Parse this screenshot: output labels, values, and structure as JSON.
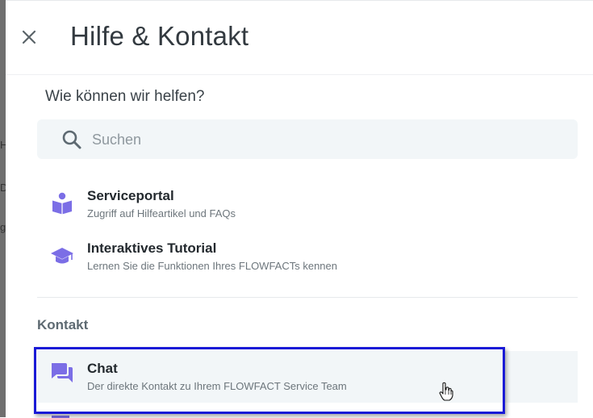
{
  "backdrop": {
    "letters": [
      "H",
      "D",
      "g"
    ]
  },
  "header": {
    "title": "Hilfe & Kontakt",
    "close_icon": "close-icon"
  },
  "help": {
    "question": "Wie können wir helfen?",
    "search": {
      "placeholder": "Suchen",
      "value": "",
      "icon": "search-icon"
    },
    "items": [
      {
        "icon": "book-reader-icon",
        "title": "Serviceportal",
        "subtitle": "Zugriff auf Hilfeartikel und FAQs"
      },
      {
        "icon": "graduation-cap-icon",
        "title": "Interaktives Tutorial",
        "subtitle": "Lernen Sie die Funktionen Ihres FLOWFACTs kennen"
      }
    ]
  },
  "contact": {
    "label": "Kontakt",
    "items": [
      {
        "icon": "chat-icon",
        "title": "Chat",
        "subtitle": "Der direkte Kontakt zu Ihrem FLOWFACT Service Team"
      }
    ]
  },
  "colors": {
    "accent_icon": "#7b6ee6",
    "highlight_border": "#1a1ad6",
    "row_background": "#f2f6f8"
  }
}
